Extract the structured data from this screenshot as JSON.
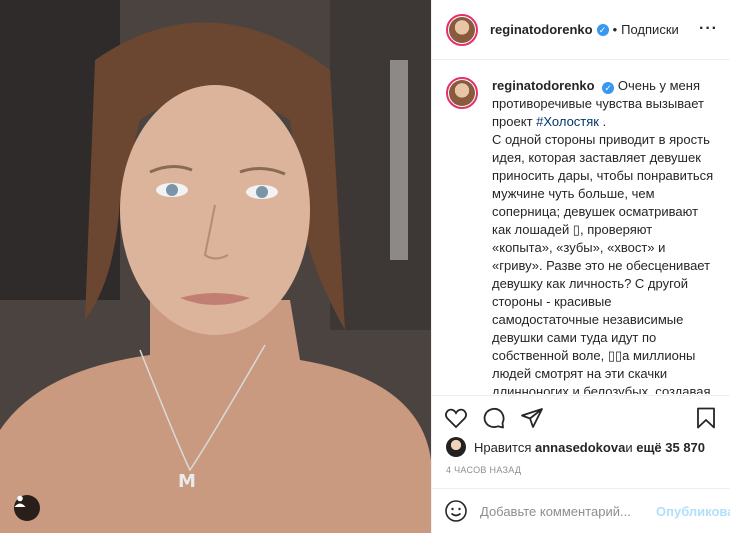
{
  "post": {
    "username": "reginatodorenko",
    "verified_mark": "✓",
    "follow_label": "Подписки",
    "dot": "•",
    "more": "···"
  },
  "caption": {
    "intro": "Очень у меня противоречивые чувства вызывает проект ",
    "hashtag": "#Холостяк",
    "after_hashtag": " .",
    "body": "С одной стороны приводит в ярость идея, которая заставляет девушек приносить дары, чтобы понравиться мужчине чуть больше, чем соперница; девушек осматривают как лошадей ▯, проверяют «копыта», «зубы», «хвост» и «гриву». Разве это не обесценивает девушку как личность? С другой стороны - красивые самодостаточные независимые девушки сами туда идут по собственной воле, ▯▯а миллионы людей смотрят на эти скачки длинноногих и белозубых, создавая рейтинг и формируя новые социальные принципы▯, а с третьей"
  },
  "likes": {
    "prefix": "Нравится ",
    "user": "annasedokova",
    "middle": " и ",
    "count": "ещё 35 870"
  },
  "timestamp": "4 часов назад",
  "comment": {
    "placeholder": "Добавьте комментарий...",
    "publish": "Опубликовать"
  },
  "icons": {
    "like": "heart-icon",
    "comment": "comment-icon",
    "share": "share-icon",
    "save": "bookmark-icon",
    "emoji": "emoji-icon",
    "user_tag": "user-tag-icon"
  },
  "colors": {
    "verified": "#3897f0",
    "hashtag": "#00376b",
    "publish_disabled": "#b2dffc",
    "story_ring": "#e1306c"
  }
}
